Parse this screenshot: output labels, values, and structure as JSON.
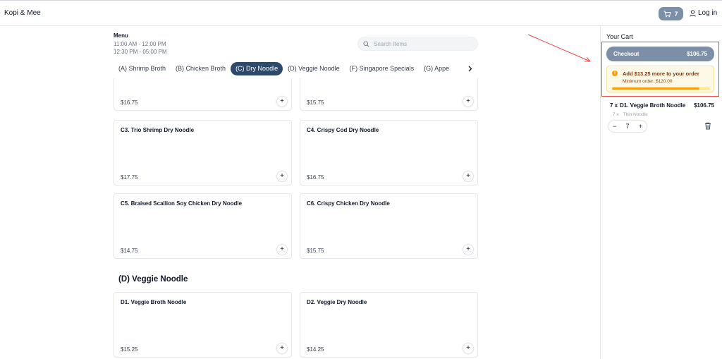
{
  "header": {
    "brand": "Kopi & Mee",
    "cart_count": "7",
    "login_label": "Log in"
  },
  "menu": {
    "title": "Menu",
    "hours": [
      "11:00 AM - 12:00 PM",
      "12:30 PM - 05:00 PM"
    ],
    "search_placeholder": "Search Items"
  },
  "tabs": [
    {
      "label": "(A) Shrimp Broth",
      "active": false
    },
    {
      "label": "(B) Chicken Broth",
      "active": false
    },
    {
      "label": "(C) Dry Noodle",
      "active": true
    },
    {
      "label": "(D) Veggie Noodle",
      "active": false
    },
    {
      "label": "(F) Singapore Specials",
      "active": false
    },
    {
      "label": "(G) Appe",
      "active": false
    }
  ],
  "items": [
    {
      "name": "",
      "price": "$16.75"
    },
    {
      "name": "",
      "price": "$15.75"
    },
    {
      "name": "C3. Trio Shrimp Dry Noodle",
      "price": "$17.75"
    },
    {
      "name": "C4. Crispy Cod Dry Noodle",
      "price": "$16.75"
    },
    {
      "name": "C5. Braised Scallion Soy Chicken Dry Noodle",
      "price": "$14.75"
    },
    {
      "name": "C6. Crispy Chicken Dry Noodle",
      "price": "$15.75"
    },
    {
      "name": "D1. Veggie Broth Noodle",
      "price": "$15.25"
    },
    {
      "name": "D2. Veggie Dry Noodle",
      "price": "$14.25"
    }
  ],
  "section_d_title": "(D) Veggie Noodle",
  "cart": {
    "title": "Your Cart",
    "checkout_label": "Checkout",
    "total": "$106.75",
    "notice_message": "Add $13.25 more to your order",
    "notice_min": "Minimum order: $120.00",
    "progress_fraction": 0.89,
    "item": {
      "qty_prefix": "7 x",
      "name": "D1. Veggie Broth Noodle",
      "price": "$106.75",
      "sub_qty": "7 x",
      "sub_option": "Thin Noodle",
      "quantity": "7"
    }
  },
  "colors": {
    "accent": "#2e4a6b",
    "cart_button": "#7d8fa6",
    "annotation": "#ef4444",
    "warning": "#f59e0b"
  }
}
